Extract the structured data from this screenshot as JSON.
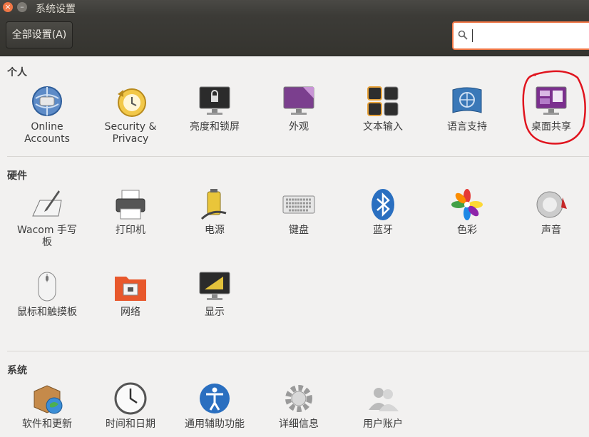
{
  "window": {
    "title": "系统设置"
  },
  "toolbar": {
    "all_settings": "全部设置(A)",
    "search_value": ""
  },
  "sections": {
    "personal": "个人",
    "hardware": "硬件",
    "system": "系统"
  },
  "personal": [
    {
      "label": "Online\nAccounts",
      "icon": "online-accounts-icon"
    },
    {
      "label": "Security &\nPrivacy",
      "icon": "security-privacy-icon"
    },
    {
      "label": "亮度和锁屏",
      "icon": "brightness-lock-icon"
    },
    {
      "label": "外观",
      "icon": "appearance-icon"
    },
    {
      "label": "文本输入",
      "icon": "text-entry-icon"
    },
    {
      "label": "语言支持",
      "icon": "language-support-icon"
    },
    {
      "label": "桌面共享",
      "icon": "desktop-sharing-icon"
    }
  ],
  "hardware": [
    {
      "label": "Wacom 手写\n板",
      "icon": "wacom-tablet-icon"
    },
    {
      "label": "打印机",
      "icon": "printer-icon"
    },
    {
      "label": "电源",
      "icon": "power-icon"
    },
    {
      "label": "键盘",
      "icon": "keyboard-icon"
    },
    {
      "label": "蓝牙",
      "icon": "bluetooth-icon"
    },
    {
      "label": "色彩",
      "icon": "color-icon"
    },
    {
      "label": "声音",
      "icon": "sound-icon"
    },
    {
      "label": "鼠标和触摸板",
      "icon": "mouse-touchpad-icon"
    },
    {
      "label": "网络",
      "icon": "network-icon"
    },
    {
      "label": "显示",
      "icon": "display-icon"
    }
  ],
  "system": [
    {
      "label": "软件和更新",
      "icon": "software-updates-icon"
    },
    {
      "label": "时间和日期",
      "icon": "time-date-icon"
    },
    {
      "label": "通用辅助功能",
      "icon": "universal-access-icon"
    },
    {
      "label": "详细信息",
      "icon": "details-icon"
    },
    {
      "label": "用户账户",
      "icon": "user-accounts-icon"
    }
  ],
  "annotation": {
    "color": "#e0141e"
  }
}
